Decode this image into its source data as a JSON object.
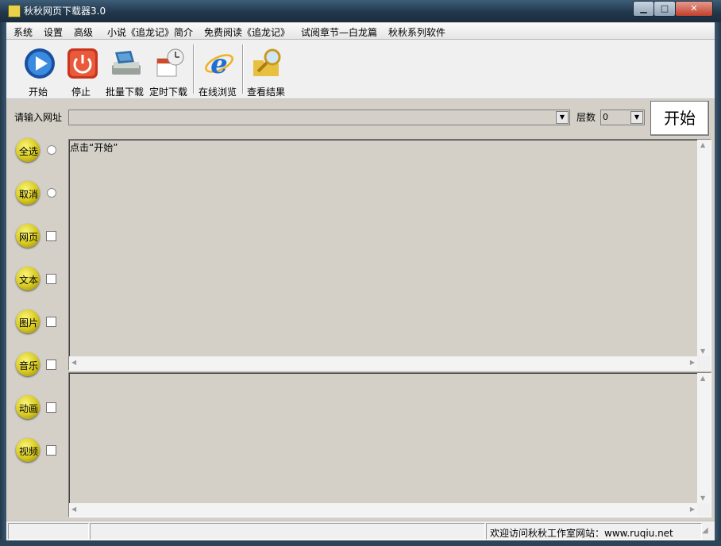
{
  "window": {
    "title": "秋秋网页下载器3.0",
    "minimize": "▁",
    "maximize": "□",
    "close": "✕"
  },
  "menu": [
    "系统",
    "设置",
    "高级",
    "小说《追龙记》简介",
    "免费阅读《追龙记》",
    "试阅章节—白龙篇",
    "秋秋系列软件"
  ],
  "toolbar": [
    {
      "label": "开始",
      "icon": "play-icon"
    },
    {
      "label": "停止",
      "icon": "power-icon"
    },
    {
      "label": "批量下载",
      "icon": "batch-download-icon"
    },
    {
      "label": "定时下载",
      "icon": "calendar-clock-icon"
    },
    {
      "label": "在线浏览",
      "icon": "ie-browser-icon"
    },
    {
      "label": "查看结果",
      "icon": "folder-search-icon"
    }
  ],
  "url": {
    "label": "请输入网址",
    "value": ""
  },
  "layers": {
    "label": "层数",
    "value": "0"
  },
  "start_button": "开始",
  "options": [
    {
      "label": "全选",
      "control": "radio"
    },
    {
      "label": "取消",
      "control": "radio"
    },
    {
      "label": "网页",
      "control": "checkbox"
    },
    {
      "label": "文本",
      "control": "checkbox"
    },
    {
      "label": "图片",
      "control": "checkbox"
    },
    {
      "label": "音乐",
      "control": "checkbox"
    },
    {
      "label": "动画",
      "control": "checkbox"
    },
    {
      "label": "视频",
      "control": "checkbox"
    }
  ],
  "log": "点击“开始”",
  "status": {
    "text": "欢迎访问秋秋工作室网站：www.ruqiu.net"
  },
  "colors": {
    "accent_ball": "#d6c81e",
    "panel_bg": "#d4d0c8"
  }
}
